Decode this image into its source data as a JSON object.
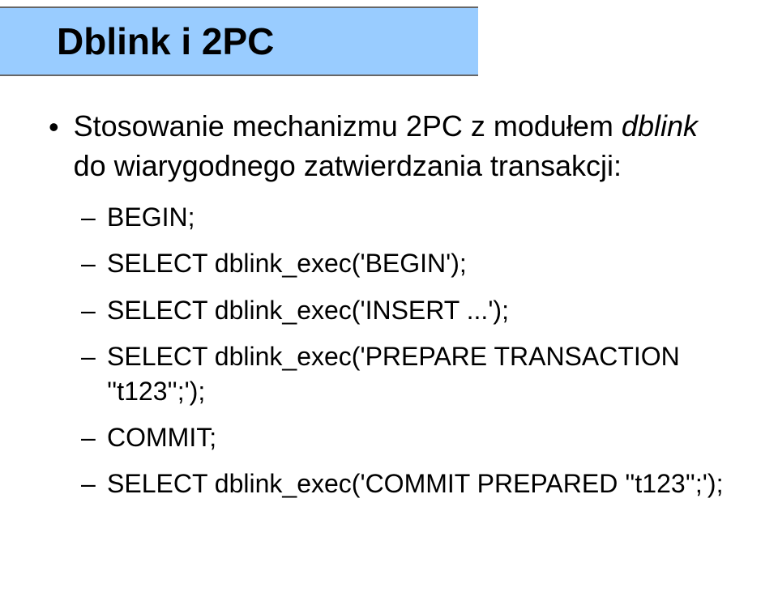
{
  "title": "Dblink i 2PC",
  "bullet": {
    "text_before": "Stosowanie mechanizmu 2PC z modułem ",
    "italic_word": "dblink",
    "text_after": " do wiarygodnego zatwierdzania transakcji:"
  },
  "subitems": [
    "BEGIN;",
    "SELECT dblink_exec('BEGIN');",
    "SELECT dblink_exec('INSERT ...');",
    "SELECT dblink_exec('PREPARE TRANSACTION ''t123'';');",
    "COMMIT;",
    "SELECT dblink_exec('COMMIT PREPARED ''t123'';');"
  ]
}
